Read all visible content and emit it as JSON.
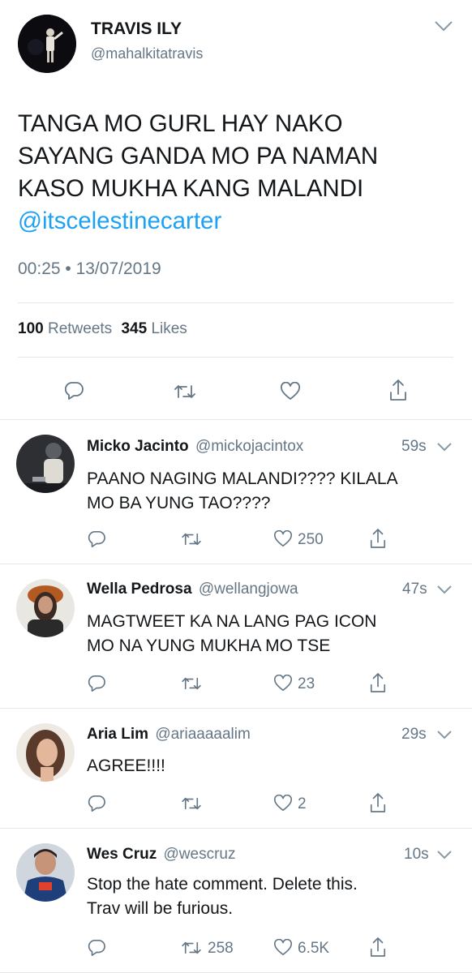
{
  "main_tweet": {
    "name": "TRAVIS ILY",
    "handle": "@mahalkitatravis",
    "text_lines": [
      "TANGA MO GURL HAY NAKO",
      "SAYANG GANDA MO PA NAMAN",
      "KASO MUKHA KANG MALANDI"
    ],
    "mention": "@itscelestinecarter",
    "time": "00:25 • 13/07/2019",
    "retweets_count": "100",
    "retweets_label": "Retweets",
    "likes_count": "345",
    "likes_label": "Likes"
  },
  "replies": [
    {
      "name": "Micko Jacinto",
      "handle": "@mickojacintox",
      "time": "59s",
      "lines": [
        "PAANO NAGING MALANDI???? KILALA",
        "MO BA YUNG TAO????"
      ],
      "retweets": "",
      "likes": "250"
    },
    {
      "name": "Wella Pedrosa",
      "handle": "@wellangjowa",
      "time": "47s",
      "lines": [
        "MAGTWEET KA NA LANG PAG ICON",
        "MO NA YUNG MUKHA MO TSE"
      ],
      "retweets": "",
      "likes": "23"
    },
    {
      "name": "Aria Lim",
      "handle": "@ariaaaaalim",
      "time": "29s",
      "lines": [
        "AGREE!!!!"
      ],
      "retweets": "",
      "likes": "2"
    },
    {
      "name": "Wes Cruz",
      "handle": "@wescruz",
      "time": "10s",
      "lines": [
        "Stop the hate comment. Delete this.",
        "Trav will be furious."
      ],
      "retweets": "258",
      "likes": "6.5K"
    }
  ],
  "colors": {
    "link": "#1da1f2",
    "muted": "#657786",
    "divider": "#e1e8ed"
  }
}
